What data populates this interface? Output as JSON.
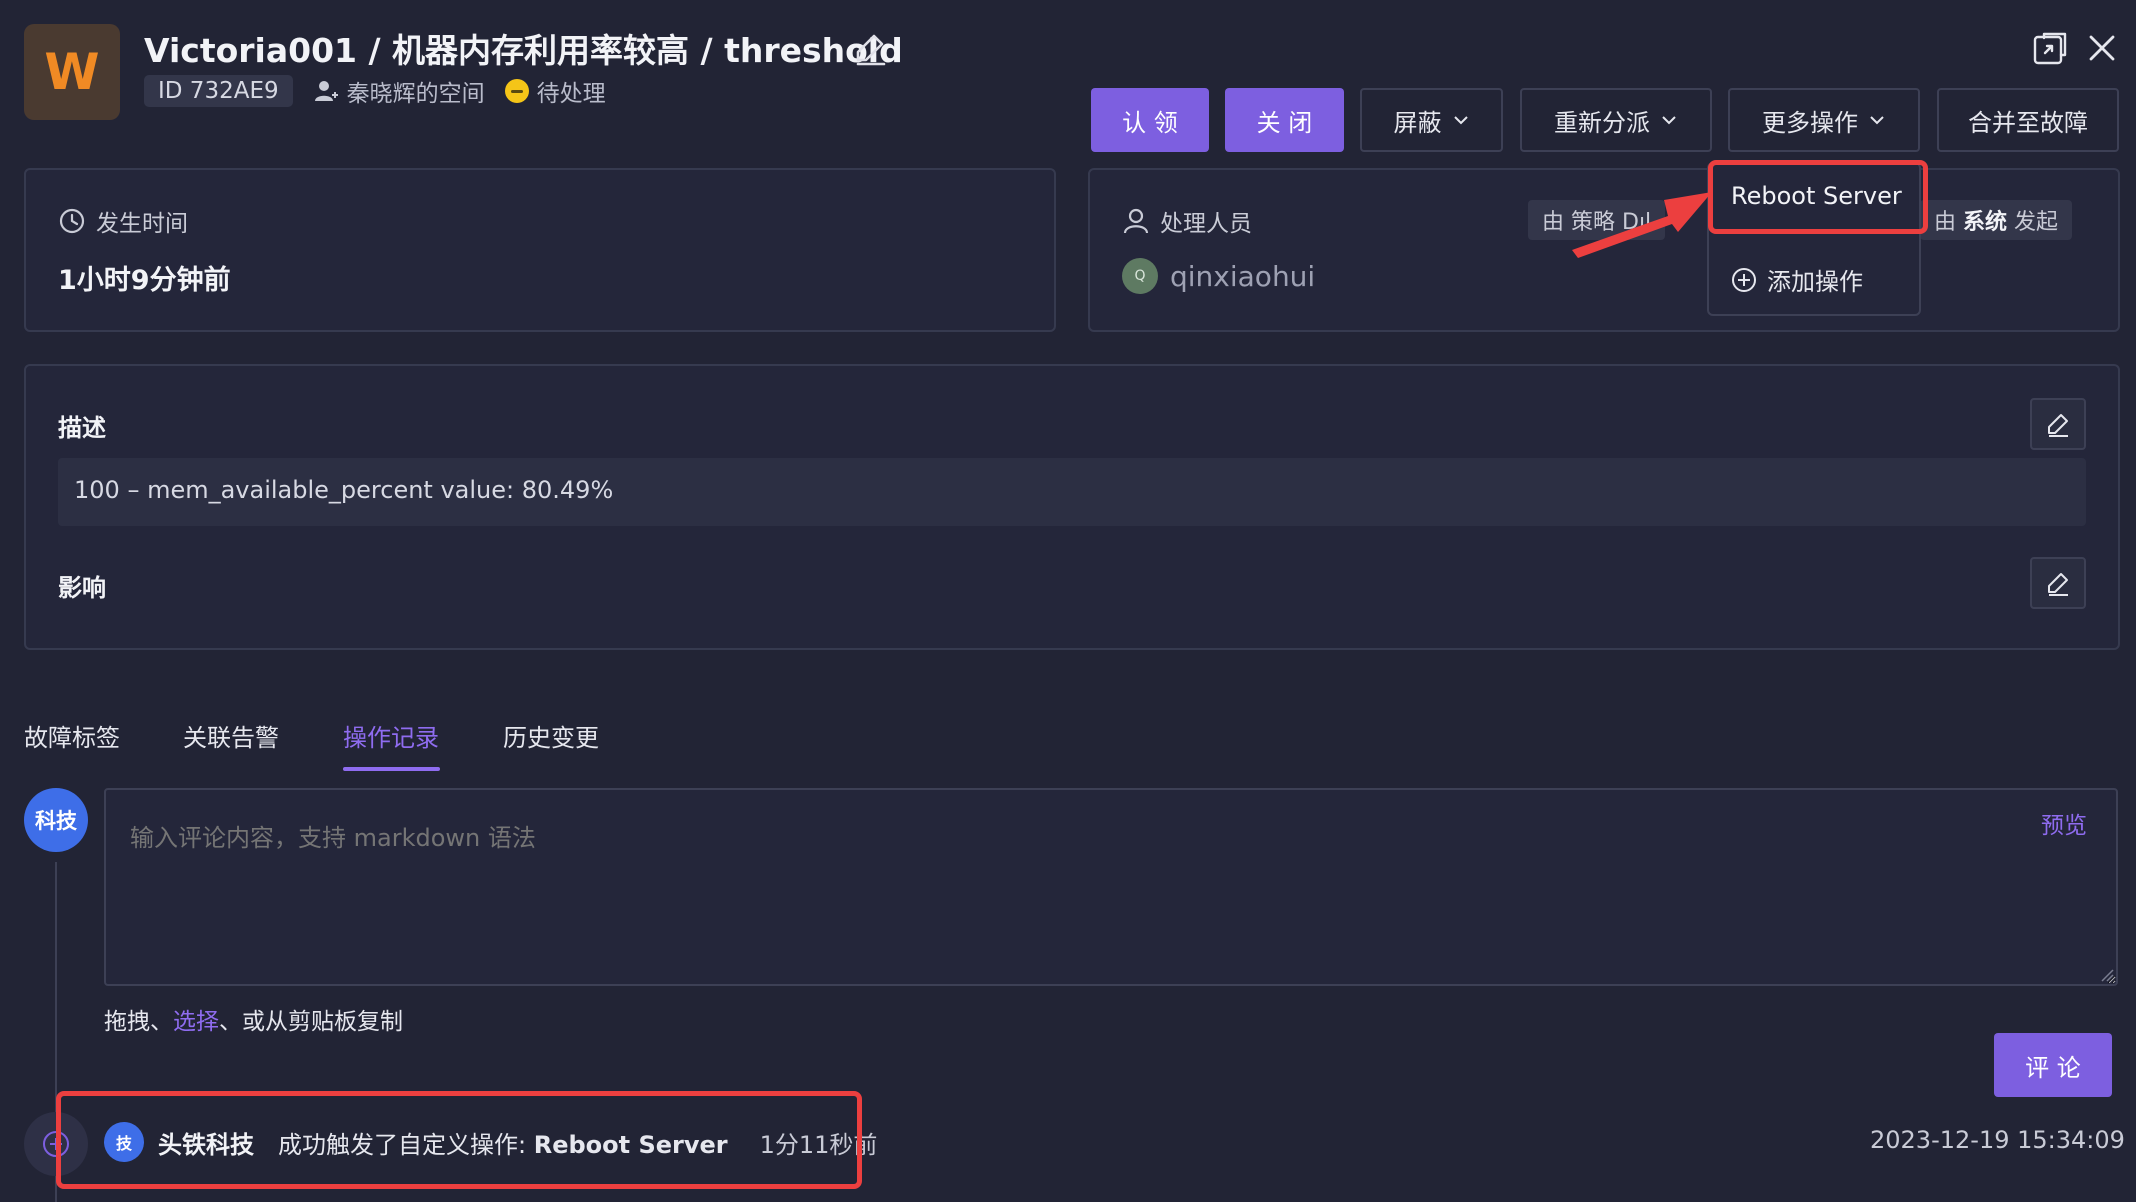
{
  "header": {
    "avatar_letter": "W",
    "title": "Victoria001 / 机器内存利用率较高 / threshold",
    "id_label": "ID 732AE9",
    "space": "秦晓辉的空间",
    "status": "待处理"
  },
  "actions": {
    "claim": "认 领",
    "close": "关 闭",
    "mute": "屏蔽",
    "reassign": "重新分派",
    "more": "更多操作",
    "merge": "合并至故障"
  },
  "dropdown": {
    "items": [
      "Reboot Server",
      "添加操作"
    ]
  },
  "time_card": {
    "label": "发生时间",
    "value": "1小时9分钟前"
  },
  "assignee_card": {
    "label": "处理人员",
    "assignee_initial": "Q",
    "assignee": "qinxiaohui",
    "policy_prefix": "由 策略 D",
    "policy_trunc": "ıl",
    "system_prefix": "由",
    "system_name": "系统",
    "system_suffix": "发起"
  },
  "details": {
    "description_label": "描述",
    "description_value": "100 – mem_available_percent value: 80.49%",
    "impact_label": "影响"
  },
  "tabs": [
    {
      "label": "故障标签",
      "active": false
    },
    {
      "label": "关联告警",
      "active": false
    },
    {
      "label": "操作记录",
      "active": true
    },
    {
      "label": "历史变更",
      "active": false
    }
  ],
  "comment": {
    "user_avatar": "科技",
    "placeholder": "输入评论内容，支持 markdown 语法",
    "preview": "预览",
    "upload_prefix": "拖拽、",
    "upload_link": "选择",
    "upload_suffix": "、或从剪贴板复制",
    "submit": "评 论"
  },
  "timeline": [
    {
      "avatar": "技",
      "user": "头铁科技",
      "action_prefix": "成功触发了自定义操作: ",
      "action_name": "Reboot Server",
      "relative_time": "1分11秒前",
      "timestamp": "2023-12-19 15:34:09"
    }
  ],
  "colors": {
    "background": "#222435",
    "accent": "#7d5fe0",
    "highlight": "#ec3f3f",
    "status_pending": "#f5c518",
    "logo_orange": "#f08a24"
  }
}
